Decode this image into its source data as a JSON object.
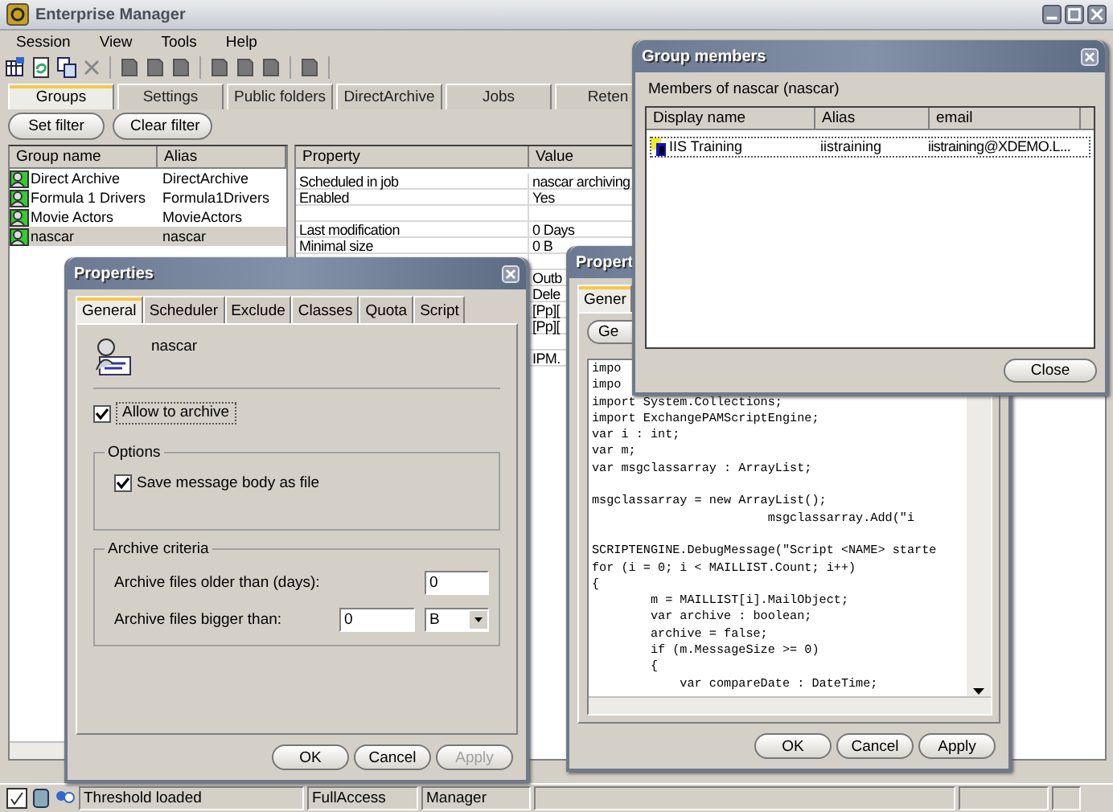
{
  "window": {
    "title": "Enterprise Manager"
  },
  "menu": [
    "Session",
    "View",
    "Tools",
    "Help"
  ],
  "tabs": [
    {
      "label": "Groups",
      "selected": true
    },
    {
      "label": "Settings",
      "selected": false
    },
    {
      "label": "Public folders",
      "selected": false
    },
    {
      "label": "DirectArchive",
      "selected": false
    },
    {
      "label": "Jobs",
      "selected": false
    },
    {
      "label": "Reten",
      "selected": false
    }
  ],
  "filter_buttons": [
    "Set filter",
    "Clear filter"
  ],
  "groups": {
    "columns": [
      "Group name",
      "Alias"
    ],
    "rows": [
      {
        "name": "Direct Archive",
        "alias": "DirectArchive",
        "selected": false
      },
      {
        "name": "Formula 1 Drivers",
        "alias": "Formula1Drivers",
        "selected": false
      },
      {
        "name": "Movie Actors",
        "alias": "MovieActors",
        "selected": false
      },
      {
        "name": "nascar",
        "alias": "nascar",
        "selected": true
      }
    ]
  },
  "properties": {
    "columns": [
      "Property",
      "Value"
    ],
    "rows": [
      {
        "property": "Scheduled in job",
        "value": "nascar archiving"
      },
      {
        "property": "Enabled",
        "value": "Yes"
      },
      {},
      {
        "property": "Last modification",
        "value": "0 Days"
      },
      {
        "property": "Minimal size",
        "value": "0 B"
      },
      {},
      {
        "value": "Outb"
      },
      {
        "value": "Dele"
      },
      {
        "value": "[Pp]["
      },
      {
        "value": "[Pp]["
      },
      {},
      {
        "value": "IPM."
      }
    ]
  },
  "status_bar": [
    "Threshold loaded",
    "FullAccess",
    "Manager"
  ],
  "properties_dialog": {
    "title": "Properties",
    "tabs": [
      {
        "label": "General",
        "selected": true
      },
      {
        "label": "Scheduler",
        "selected": false
      },
      {
        "label": "Exclude",
        "selected": false
      },
      {
        "label": "Classes",
        "selected": false
      },
      {
        "label": "Quota",
        "selected": false
      },
      {
        "label": "Script",
        "selected": false
      }
    ],
    "group_name": "nascar",
    "allow": {
      "label": "Allow to archive",
      "checked": true
    },
    "options": {
      "legend": "Options",
      "label": "Save message body as file",
      "checked": true
    },
    "criteria": {
      "legend": "Archive criteria",
      "older_label": "Archive files older than (days):",
      "older_value": "0",
      "bigger_label": "Archive files bigger than:",
      "bigger_value": "0",
      "unit": "B"
    },
    "buttons": [
      {
        "label": "OK",
        "disabled": false
      },
      {
        "label": "Cancel",
        "disabled": false
      },
      {
        "label": "Apply",
        "disabled": true
      }
    ]
  },
  "script_dialog": {
    "title": "Propert",
    "tab": {
      "label": "Gener",
      "selected": true
    },
    "button": "Ge",
    "code": "impo\nimpo\nimport System.Collections;\nimport ExchangePAMScriptEngine;\nvar i : int;\nvar m;\nvar msgclassarray : ArrayList;\n\nmsgclassarray = new ArrayList();\n                        msgclassarray.Add(\"i\n\nSCRIPTENGINE.DebugMessage(\"Script <NAME> starte\nfor (i = 0; i < MAILLIST.Count; i++)\n{\n        m = MAILLIST[i].MailObject;\n        var archive : boolean;\n        archive = false;\n        if (m.MessageSize >= 0)\n        {\n            var compareDate : DateTime;",
    "buttons": [
      {
        "label": "OK",
        "disabled": false
      },
      {
        "label": "Cancel",
        "disabled": false
      },
      {
        "label": "Apply",
        "disabled": false
      }
    ]
  },
  "members_dialog": {
    "title": "Group members",
    "caption": "Members of  nascar (nascar)",
    "columns": [
      "Display name",
      "Alias",
      "email"
    ],
    "rows": [
      {
        "display_name": "IIS Training",
        "alias": "iistraining",
        "email": "iistraining@XDEMO.L...",
        "selected": true
      }
    ],
    "button": "Close"
  }
}
